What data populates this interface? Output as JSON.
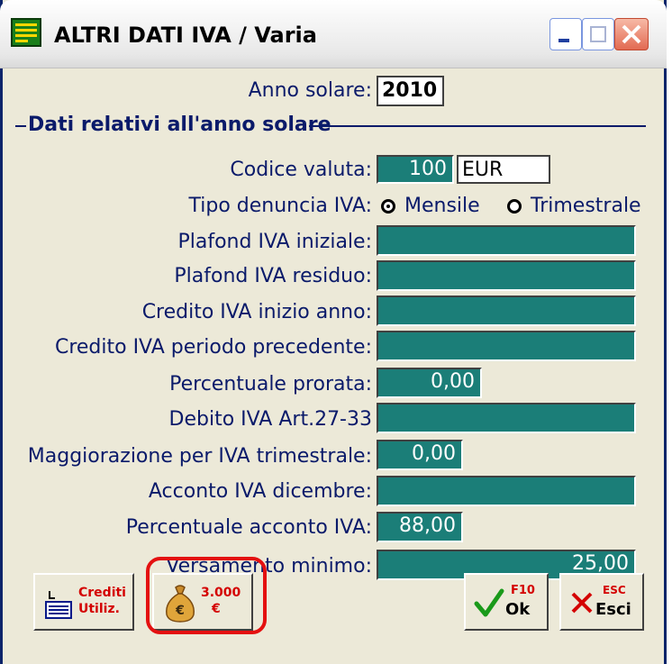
{
  "window": {
    "title": "ALTRI DATI IVA / Varia"
  },
  "anno": {
    "label": "Anno solare:",
    "value": "2010"
  },
  "section_title": "Dati relativi all'anno solare",
  "codice_valuta": {
    "label": "Codice valuta:",
    "number": "100",
    "code": "EUR"
  },
  "tipo_denuncia": {
    "label": "Tipo denuncia IVA:",
    "option1": "Mensile",
    "option2": "Trimestrale",
    "selected": "Mensile"
  },
  "fields": {
    "plafond_iniziale": {
      "label": "Plafond IVA iniziale:",
      "value": ""
    },
    "plafond_residuo": {
      "label": "Plafond IVA residuo:",
      "value": ""
    },
    "credito_inizio": {
      "label": "Credito IVA inizio anno:",
      "value": ""
    },
    "credito_periodo": {
      "label": "Credito IVA periodo precedente:",
      "value": ""
    },
    "prorata": {
      "label": "Percentuale prorata:",
      "value": "0,00"
    },
    "debito": {
      "label": "Debito IVA Art.27-33",
      "value": ""
    },
    "maggiorazione": {
      "label": "Maggiorazione per IVA trimestrale:",
      "value": "0,00"
    },
    "acconto_dic": {
      "label": "Acconto IVA dicembre:",
      "value": ""
    },
    "perc_acconto": {
      "label": "Percentuale acconto IVA:",
      "value": "88,00"
    },
    "versamento": {
      "label": "Versamento minimo:",
      "value": "25,00"
    }
  },
  "buttons": {
    "crediti": {
      "line1": "Crediti",
      "line2": "Utiliz."
    },
    "soglia": {
      "line1": "3.000",
      "line2": "€"
    },
    "ok": {
      "key": "F10",
      "label": "Ok"
    },
    "esci": {
      "key": "ESC",
      "label": "Esci"
    }
  },
  "colors": {
    "field": "#1b7e78",
    "label": "#0a1a6a",
    "highlight": "#e41010"
  }
}
